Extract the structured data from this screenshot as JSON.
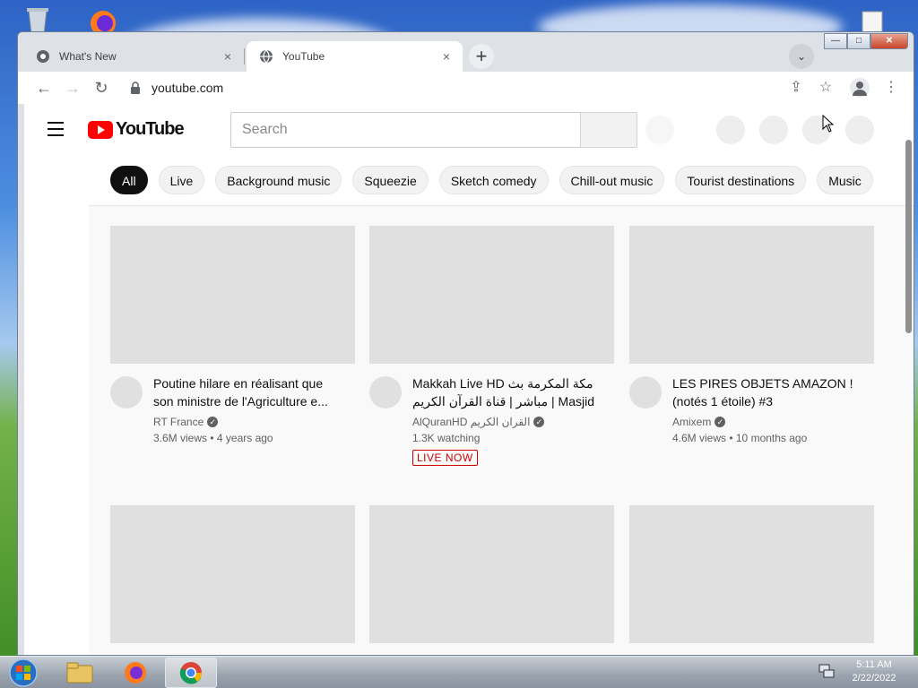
{
  "browser": {
    "tabs": [
      {
        "title": "What's New",
        "active": false
      },
      {
        "title": "YouTube",
        "active": true
      }
    ],
    "close_glyph": "×",
    "new_tab_glyph": "+",
    "tab_search_glyph": "⌄",
    "url": "youtube.com",
    "nav": {
      "back": "←",
      "forward": "→",
      "reload": "↻"
    },
    "toolbar_glyphs": {
      "share": "⇪",
      "bookmark": "☆",
      "menu": "⋮"
    },
    "window_controls": {
      "minimize": "—",
      "maximize": "□",
      "close": "✕"
    }
  },
  "youtube": {
    "logo_text": "YouTube",
    "search_placeholder": "Search",
    "chips": [
      {
        "label": "All",
        "active": true
      },
      {
        "label": "Live",
        "active": false
      },
      {
        "label": "Background music",
        "active": false
      },
      {
        "label": "Squeezie",
        "active": false
      },
      {
        "label": "Sketch comedy",
        "active": false
      },
      {
        "label": "Chill-out music",
        "active": false
      },
      {
        "label": "Tourist destinations",
        "active": false
      },
      {
        "label": "Music",
        "active": false
      }
    ],
    "videos": [
      {
        "title": "Poutine hilare en réalisant que son ministre de l'Agriculture e...",
        "channel": "RT France",
        "stats": "3.6M views • 4 years ago",
        "live": false
      },
      {
        "title": "Makkah Live HD مكة المكرمة بث مباشر | قناة القرآن الكريم | Masjid Al...",
        "channel": "AlQuranHD القران الكريم",
        "stats": "1.3K watching",
        "live": true,
        "live_label": "LIVE NOW"
      },
      {
        "title": "LES PIRES OBJETS AMAZON ! (notés 1 étoile) #3",
        "channel": "Amixem",
        "stats": "4.6M views • 10 months ago",
        "live": false
      }
    ],
    "verified_glyph": "✓"
  },
  "taskbar": {
    "time": "5:11 AM",
    "date": "2/22/2022"
  },
  "colors": {
    "youtube_red": "#ff0000",
    "chip_active_bg": "#0f0f0f",
    "live_red": "#cc0000",
    "tab_bar": "#dee1e6"
  }
}
